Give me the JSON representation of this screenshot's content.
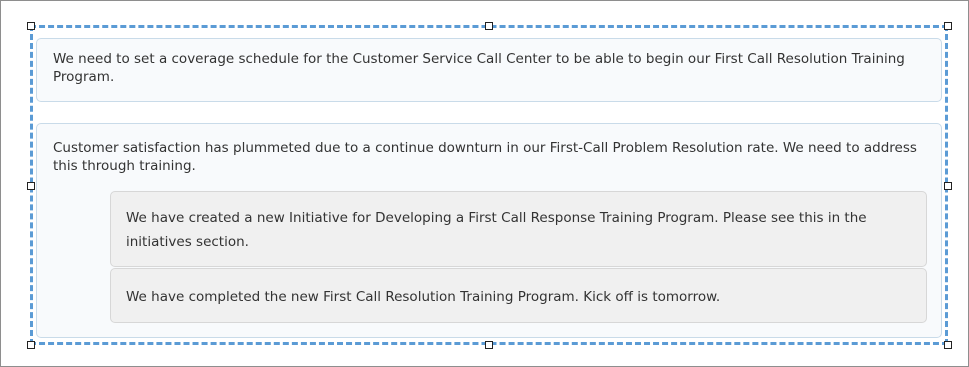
{
  "comments": [
    {
      "text": "We need to set a coverage schedule for the Customer Service Call Center to be able to begin our First Call Resolution Training Program."
    },
    {
      "text": "Customer satisfaction has plummeted due to a continue downturn in our First-Call Problem Resolution rate. We need to address this through training.",
      "replies": [
        {
          "text": "We have created a new Initiative for Developing a First Call Response Training Program. Please see this in the initiatives section."
        },
        {
          "text": "We have completed the new First Call Resolution Training Program. Kick off is tomorrow."
        }
      ]
    }
  ],
  "colors": {
    "selection_border": "#5b9bd5",
    "card_border": "#c9dbe9",
    "card_background": "#f8fafc",
    "reply_background": "#f0f0f0"
  }
}
